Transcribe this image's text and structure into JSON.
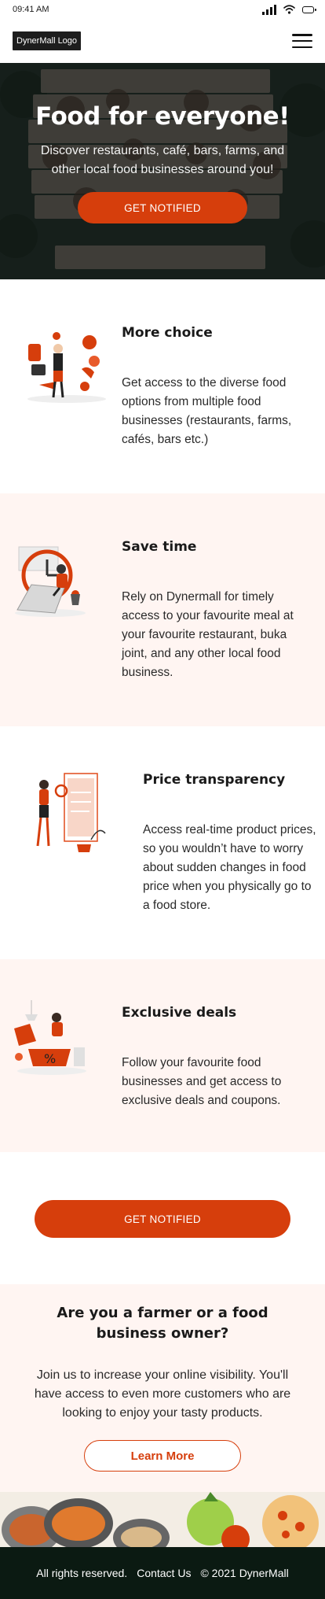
{
  "status_bar": {
    "time": "09:41 AM"
  },
  "nav": {
    "logo_text": "DynerMall Logo"
  },
  "hero": {
    "title": "Food for everyone!",
    "subtitle": "Discover restaurants, café, bars, farms, and other local food businesses around you!",
    "button_label": "GET NOTIFIED"
  },
  "features": [
    {
      "title": "More choice",
      "text": "Get access to the diverse food options from multiple food businesses (restaurants, farms, cafés, bars etc.)"
    },
    {
      "title": "Save time",
      "text": "Rely on Dynermall for timely access to your favourite meal at your favourite restaurant, buka joint, and any other local food business."
    },
    {
      "title": "Price transparency",
      "text": "Access real-time product prices, so you wouldn’t have to worry about sudden changes in food price when you physically go to a food store."
    },
    {
      "title": "Exclusive deals",
      "text": "Follow your favourite food businesses and get access to exclusive deals and coupons."
    }
  ],
  "cta": {
    "button_label": "GET NOTIFIED"
  },
  "farmer": {
    "title": "Are you a farmer or a food business owner?",
    "text": "Join us to increase your online visibility. You'll have access to even more customers who are looking to enjoy your tasty products.",
    "button_label": "Learn More"
  },
  "footer": {
    "rights": "All rights reserved.",
    "contact": "Contact Us",
    "copyright": "© 2021 DynerMall"
  },
  "colors": {
    "accent": "#d63e0c",
    "section_tint": "#fff5f2",
    "footer_bg": "#0b1a12"
  }
}
